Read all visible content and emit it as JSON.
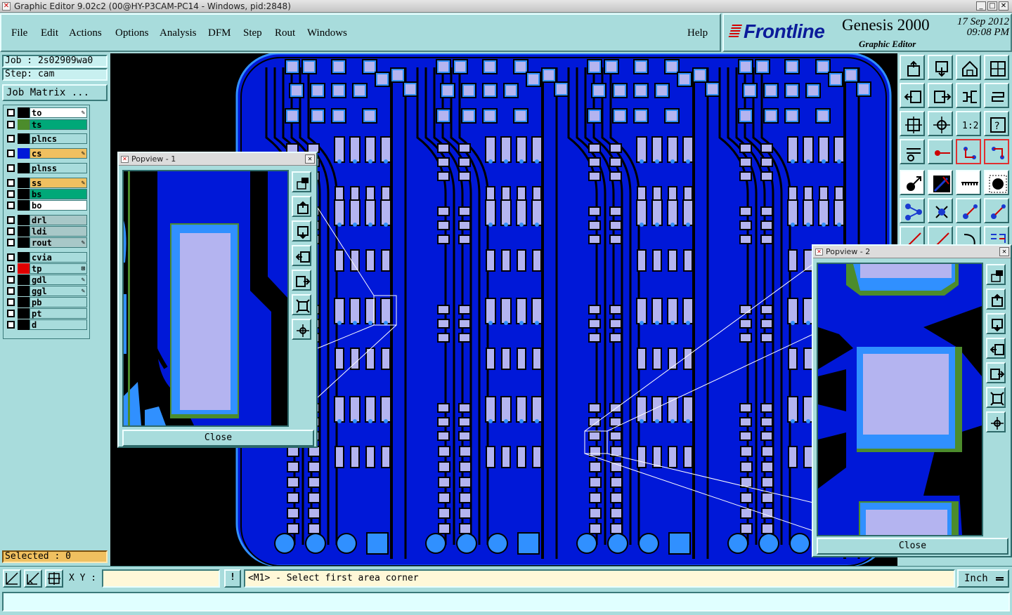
{
  "window": {
    "title": "Graphic Editor 9.02c2 (00@HY-P3CAM-PC14 - Windows, pid:2848)",
    "controls": [
      "_",
      "□",
      "✕"
    ]
  },
  "menu": {
    "items": [
      "File",
      "Edit",
      "Actions",
      "Options",
      "Analysis",
      "DFM",
      "Step",
      "Rout",
      "Windows"
    ],
    "help": "Help"
  },
  "brand": {
    "logo": "Frontline",
    "product": "Genesis 2000",
    "subtitle": "Graphic Editor",
    "date": "17  Sep  2012",
    "time": "09:08  PM"
  },
  "left": {
    "job": "Job : 2s02909wa0",
    "step": "Step: cam",
    "job_matrix": "Job Matrix ...",
    "selected": "Selected : 0"
  },
  "layers": [
    {
      "name": "to",
      "color": "#ffffff",
      "swatch": "#000000",
      "mark": "✎",
      "checked": false
    },
    {
      "name": "ts",
      "color": "#00a878",
      "swatch": "#4c8c2c",
      "mark": "",
      "checked": false
    },
    {
      "name": "plncs",
      "color": "#a8dcdc",
      "swatch": "#000000",
      "mark": "",
      "checked": false
    },
    {
      "name": "cs",
      "color": "#f0c060",
      "swatch": "#0018d8",
      "mark": "✎",
      "checked": false
    },
    {
      "name": "plnss",
      "color": "#a8dcdc",
      "swatch": "#000000",
      "mark": "",
      "checked": false
    },
    {
      "name": "ss",
      "color": "#f0c060",
      "swatch": "#000000",
      "mark": "✎",
      "checked": false
    },
    {
      "name": "bs",
      "color": "#00a878",
      "swatch": "#000000",
      "mark": "",
      "checked": false
    },
    {
      "name": "bo",
      "color": "#ffffff",
      "swatch": "#000000",
      "mark": "",
      "checked": false
    },
    {
      "name": "drl",
      "color": "#a8c8c8",
      "swatch": "#000000",
      "mark": "",
      "checked": false
    },
    {
      "name": "ldi",
      "color": "#a8c8c8",
      "swatch": "#000000",
      "mark": "",
      "checked": false
    },
    {
      "name": "rout",
      "color": "#a8c8c8",
      "swatch": "#000000",
      "mark": "✎",
      "checked": false
    },
    {
      "name": "cvia",
      "color": "#a8dcdc",
      "swatch": "#000000",
      "mark": "",
      "checked": false
    },
    {
      "name": "tp",
      "color": "#a8dcdc",
      "swatch": "#e00000",
      "mark": "⊞",
      "checked": true
    },
    {
      "name": "gdl",
      "color": "#a8dcdc",
      "swatch": "#000000",
      "mark": "✎",
      "checked": false
    },
    {
      "name": "ggl",
      "color": "#a8dcdc",
      "swatch": "#000000",
      "mark": "✎",
      "checked": false
    },
    {
      "name": "pb",
      "color": "#a8dcdc",
      "swatch": "#000000",
      "mark": "",
      "checked": false
    },
    {
      "name": "pt",
      "color": "#a8dcdc",
      "swatch": "#000000",
      "mark": "",
      "checked": false
    },
    {
      "name": "d",
      "color": "#a8dcdc",
      "swatch": "#000000",
      "mark": "",
      "checked": false
    }
  ],
  "popview1": {
    "title": "Popview - 1",
    "close_label": "Close"
  },
  "popview2": {
    "title": "Popview - 2",
    "close_label": "Close"
  },
  "status": {
    "xy_label": "X Y :",
    "xy_value": "",
    "info_label": "!",
    "prompt": "<M1> - Select first area corner",
    "units": "Inch",
    "message": ""
  },
  "colors": {
    "board": "#0018d8",
    "copper": "#3090ff",
    "pad": "#b4b4f0",
    "solder": "#4c8c2c",
    "background": "#000000"
  },
  "icons": {
    "toolbar": [
      "zoom-home-icon",
      "zoom-window-icon",
      "home-icon",
      "split-view-icon",
      "pan-left-icon",
      "pan-right-icon",
      "flip-icon",
      "route-icon",
      "fit-icon",
      "center-icon",
      "scale-1-2-icon",
      "query-icon",
      "measure-icon",
      "snap-icon",
      "connect-icon",
      "net-icon",
      "select-icon",
      "draw-icon",
      "ruler-icon",
      "dot-icon",
      "tri-icon",
      "cross-icon",
      "line-icon",
      "arc-icon"
    ]
  }
}
